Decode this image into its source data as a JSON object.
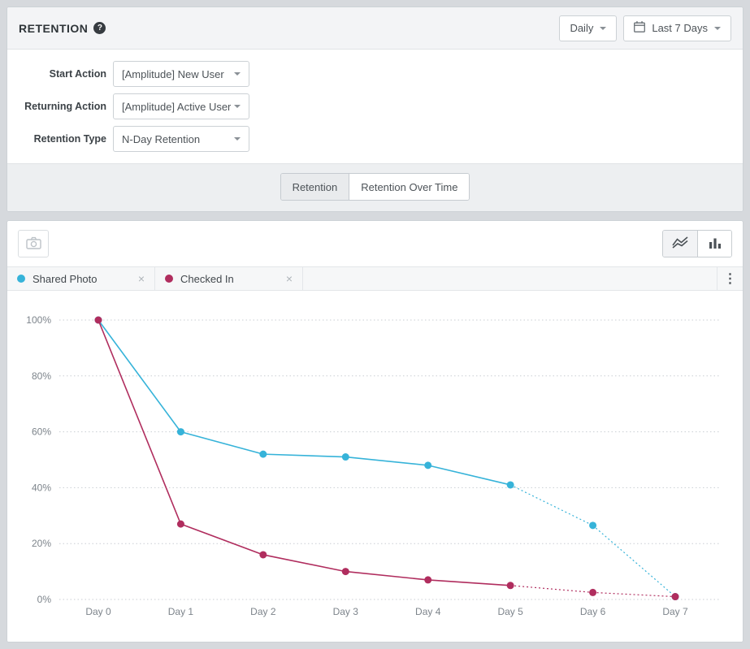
{
  "header": {
    "title": "RETENTION",
    "granularity": "Daily",
    "date_range": "Last 7 Days"
  },
  "icons": {
    "help": "?",
    "close": "×",
    "kebab": "⋮"
  },
  "form": {
    "rows": [
      {
        "label": "Start Action",
        "value": "[Amplitude] New User"
      },
      {
        "label": "Returning Action",
        "value": "[Amplitude] Active User"
      },
      {
        "label": "Retention Type",
        "value": "N-Day Retention"
      }
    ]
  },
  "tabs": [
    {
      "label": "Retention",
      "active": true
    },
    {
      "label": "Retention Over Time",
      "active": false
    }
  ],
  "legend": [
    {
      "label": "Shared Photo",
      "color": "#36b3d9"
    },
    {
      "label": "Checked In",
      "color": "#b02d5e"
    }
  ],
  "chart_data": {
    "type": "line",
    "title": "",
    "categories": [
      "Day 0",
      "Day 1",
      "Day 2",
      "Day 3",
      "Day 4",
      "Day 5",
      "Day 6",
      "Day 7"
    ],
    "series": [
      {
        "name": "Shared Photo",
        "color": "#36b3d9",
        "values": [
          100,
          60,
          52,
          51,
          48,
          41,
          26.5,
          1
        ],
        "solid_until_index": 5
      },
      {
        "name": "Checked In",
        "color": "#b02d5e",
        "values": [
          100,
          27,
          16,
          10,
          7,
          5,
          2.5,
          1
        ],
        "solid_until_index": 5
      }
    ],
    "y_ticks": [
      0,
      20,
      40,
      60,
      80,
      100
    ],
    "y_tick_suffix": "%",
    "ylim": [
      0,
      100
    ],
    "xlabel": "",
    "ylabel": "",
    "grid": "dotted-horizontal",
    "legend_position": "top"
  }
}
